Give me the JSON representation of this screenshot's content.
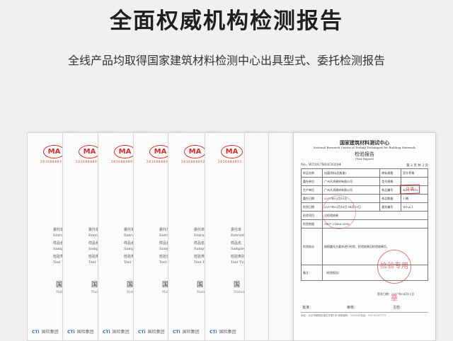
{
  "headline": "全面权威机构检测报告",
  "subline": "全线产品均取得国家建筑材料检测中心出具型式、委托检测报告",
  "docs": {
    "ma_label": "MA",
    "ma_number": "2016000092",
    "field_1": "委托单",
    "field_2": "Entrust",
    "field_3": "样品名",
    "field_4": "Sample N",
    "field_5": "检验类别",
    "field_6": "Test Typ",
    "big": "国",
    "big_sub": "Nation",
    "cti": "CTi",
    "cti_group": "国检集团"
  },
  "front": {
    "title_cn": "国家建筑材料测试中心",
    "title_en": "National Research Center of Testing Techniques for Building Materials",
    "report_cn": "检验报告",
    "report_en": "(Test Report)",
    "report_no": "No.: WT2017B03C03184",
    "page": "第 2 页 共 2 页",
    "stamp": "只读",
    "rows": [
      [
        "样品名称",
        "抗菌涂料(乳胶漆)",
        "商标规格",
        "亚什菲格"
      ],
      [
        "委托单位",
        "广州凡鸿建材有限公司",
        "型号规格",
        ""
      ],
      [
        "生产单位",
        "广州凡鸿建材有限公司",
        "样品编号",
        "B3-C-0118"
      ],
      [
        "委托日期",
        "2017年03月15日",
        "样品数量",
        "1 桶"
      ],
      [
        "检验日期",
        "2017年03月16日-04月11日",
        "委托编号",
        "WT-A-1"
      ],
      [
        "检验项目",
        "见检验结果",
        "",
        ""
      ],
      [
        "检验依据",
        "GB/T 21866-2008",
        "",
        ""
      ],
      [
        "检验结论",
        "按照委托方要求进行检验，检验结果见检验结果页。",
        "",
        ""
      ],
      [
        "备注",
        "（检验报告）",
        "",
        ""
      ]
    ],
    "seal_text": "检验专用章",
    "stamp_caption": "签发日期：2017年04月11日",
    "sig_1": "批准：",
    "sig_2": "审核：",
    "sig_3": "主检：",
    "foot": "地址：北京市朝阳区管庄东里1号  邮政编码：100024  电话：010-51167717"
  }
}
